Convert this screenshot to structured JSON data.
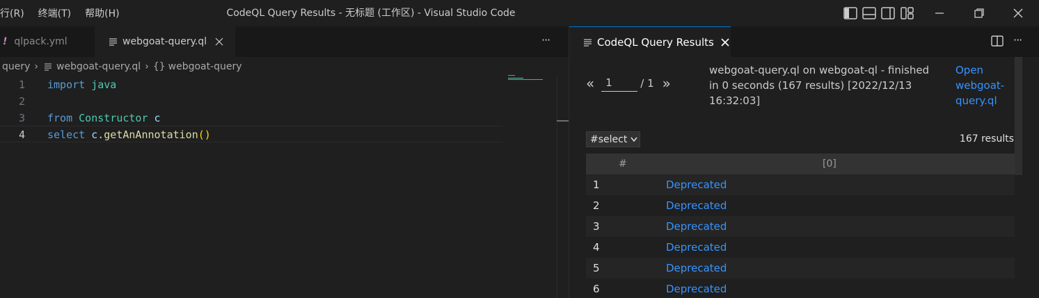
{
  "titlebar": {
    "menus": [
      "行(R)",
      "终端(T)",
      "帮助(H)"
    ],
    "title": "CodeQL Query Results - 无标题 (工作区) - Visual Studio Code"
  },
  "editor": {
    "tabs": [
      {
        "label": "qlpack.yml",
        "icon": "exclamation-icon"
      },
      {
        "label": "webgoat-query.ql",
        "icon": "lines-icon"
      }
    ],
    "more": "···",
    "breadcrumb": {
      "folder": "query",
      "file": "webgoat-query.ql",
      "symbol_icon": "{}",
      "symbol": "webgoat-query"
    },
    "lines": [
      {
        "num": "1"
      },
      {
        "num": "2"
      },
      {
        "num": "3"
      },
      {
        "num": "4"
      }
    ],
    "code": {
      "l1_kw": "import",
      "l1_mod": "java",
      "l3_kw": "from",
      "l3_type": "Constructor",
      "l3_var": "c",
      "l4_kw": "select",
      "l4_var": "c",
      "l4_dot": ".",
      "l4_fn": "getAnAnnotation",
      "l4_paren": "()"
    }
  },
  "results": {
    "tab_label": "CodeQL Query Results",
    "pager": {
      "prev": "«",
      "page": "1",
      "total": "/ 1",
      "next": "»"
    },
    "info": "webgoat-query.ql on webgoat-ql - finished in 0 seconds (167 results) [2022/12/13 16:32:03]",
    "open_link": "Open webgoat-query.ql",
    "result_set": "#select",
    "count": "167 results",
    "columns": [
      "#",
      "[0]"
    ],
    "rows": [
      {
        "num": "1",
        "value": "Deprecated"
      },
      {
        "num": "2",
        "value": "Deprecated"
      },
      {
        "num": "3",
        "value": "Deprecated"
      },
      {
        "num": "4",
        "value": "Deprecated"
      },
      {
        "num": "5",
        "value": "Deprecated"
      },
      {
        "num": "6",
        "value": "Deprecated"
      }
    ]
  },
  "colors": {
    "accent": "#0078d4",
    "link": "#3794ff",
    "keyword": "#569cd6",
    "type": "#4ec9b0"
  }
}
